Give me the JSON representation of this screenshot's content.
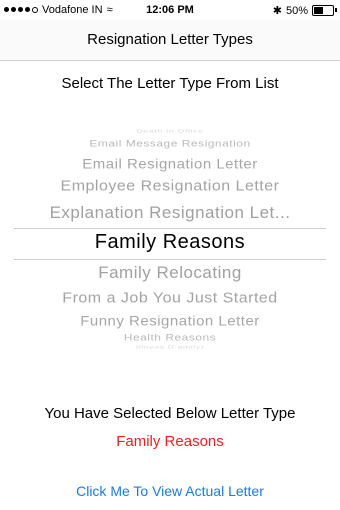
{
  "status": {
    "carrier": "Vodafone IN",
    "time": "12:06 PM",
    "battery": "50%",
    "battery_level": 0.5
  },
  "nav": {
    "title": "Resignation Letter Types"
  },
  "subtitle": "Select The Letter Type From List",
  "picker": {
    "items": [
      "Death In Office",
      "Email Message Resignation",
      "Email Resignation Letter",
      "Employee Resignation Letter",
      "Explanation Resignation Let...",
      "Family Reasons",
      "Family Relocating",
      "From a Job You Just Started",
      "Funny Resignation Letter",
      "Health Reasons",
      "Illness (Family)"
    ],
    "selected_index": 5
  },
  "selection": {
    "heading": "You Have Selected Below Letter Type",
    "value": "Family Reasons",
    "value_color": "#e62222"
  },
  "link": {
    "label": "Click Me To View Actual Letter",
    "color": "#1a7ae0"
  }
}
